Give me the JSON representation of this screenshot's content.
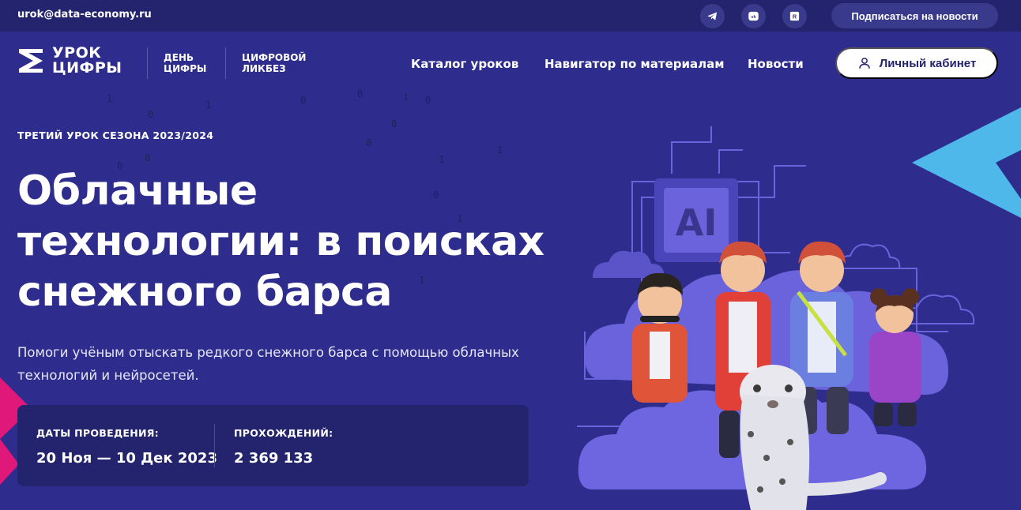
{
  "topbar": {
    "email": "urok@data-economy.ru",
    "social": [
      {
        "name": "telegram-icon"
      },
      {
        "name": "vk-icon"
      },
      {
        "name": "rutube-icon"
      }
    ],
    "subscribe_label": "Подписаться на новости"
  },
  "header": {
    "logo_line1": "УРОК",
    "logo_line2": "ЦИФРЫ",
    "sublogo1_line1": "ДЕНЬ",
    "sublogo1_line2": "ЦИФРЫ",
    "sublogo2_line1": "ЦИФРОВОЙ",
    "sublogo2_line2": "ЛИКБЕЗ",
    "nav": [
      {
        "label": "Каталог уроков"
      },
      {
        "label": "Навигатор по материалам"
      },
      {
        "label": "Новости"
      }
    ],
    "cabinet_label": "Личный кабинет"
  },
  "hero": {
    "season": "ТРЕТИЙ УРОК СЕЗОНА 2023/2024",
    "title_line1": "Облачные",
    "title_line2": "технологии: в поисках",
    "title_line3": "снежного барса",
    "description_line1": "Помоги учёным отыскать редкого снежного барса с помощью облачных",
    "description_line2": "технологий и нейросетей.",
    "stats": {
      "dates_label": "ДАТЫ ПРОВЕДЕНИЯ:",
      "dates_value": "20 Ноя — 10 Дек 2023",
      "passes_label": "ПРОХОЖДЕНИЙ:",
      "passes_value": "2 369 133"
    },
    "illustration_chip_text": "AI"
  },
  "colors": {
    "background": "#2e2d8e",
    "topbar": "#24246e",
    "accent_cyan": "#4fb8ea",
    "accent_pink": "#e0187a",
    "cloud": "#6a63dc"
  }
}
